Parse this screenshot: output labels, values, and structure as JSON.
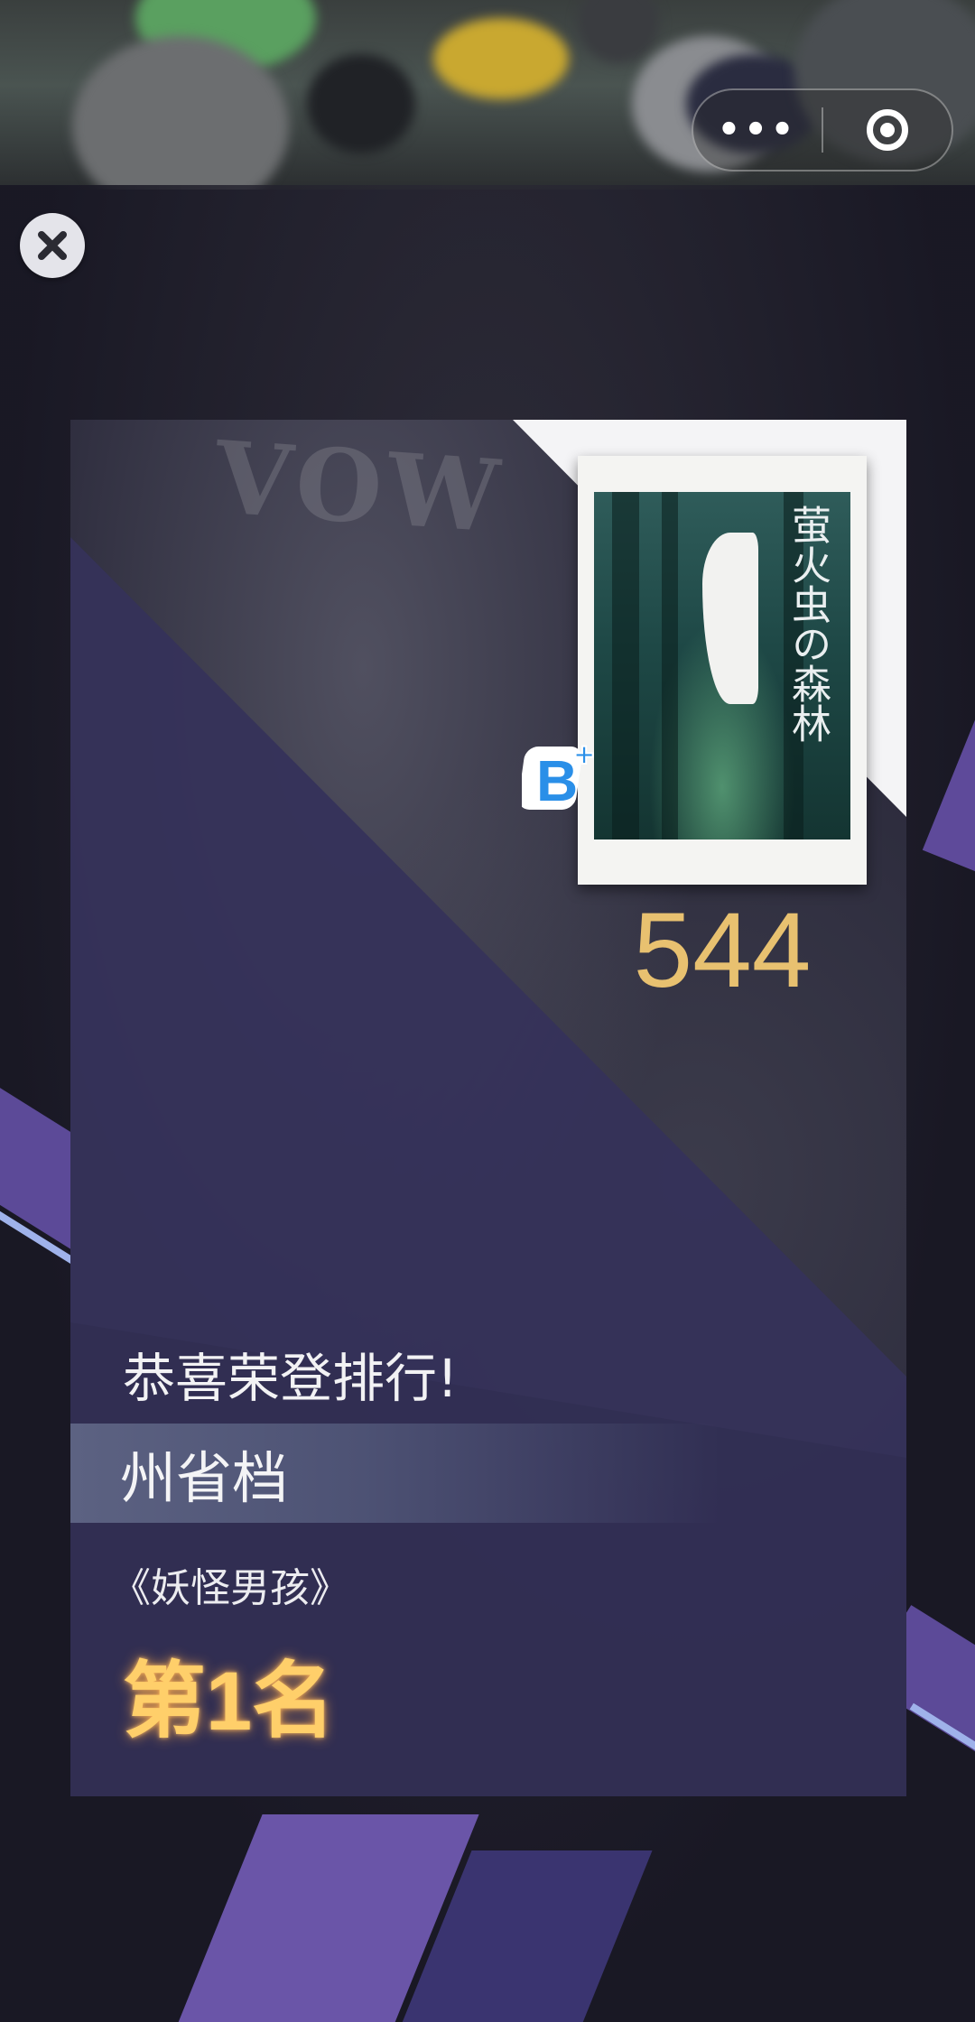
{
  "header": {
    "more_label": "•••"
  },
  "card": {
    "poster_title": "萤火虫の森林",
    "grade": "B+",
    "score": "544",
    "congrats": "恭喜荣登排行!",
    "tier": "州省档",
    "work_title": "《妖怪男孩》",
    "rank": "第1名"
  },
  "colors": {
    "score": "#e8c170",
    "rank": "#ffcf6a",
    "accent_stripe": "#6a55a8"
  },
  "icons": {
    "close": "close-icon",
    "more": "more-dots-icon",
    "target": "target-icon"
  }
}
